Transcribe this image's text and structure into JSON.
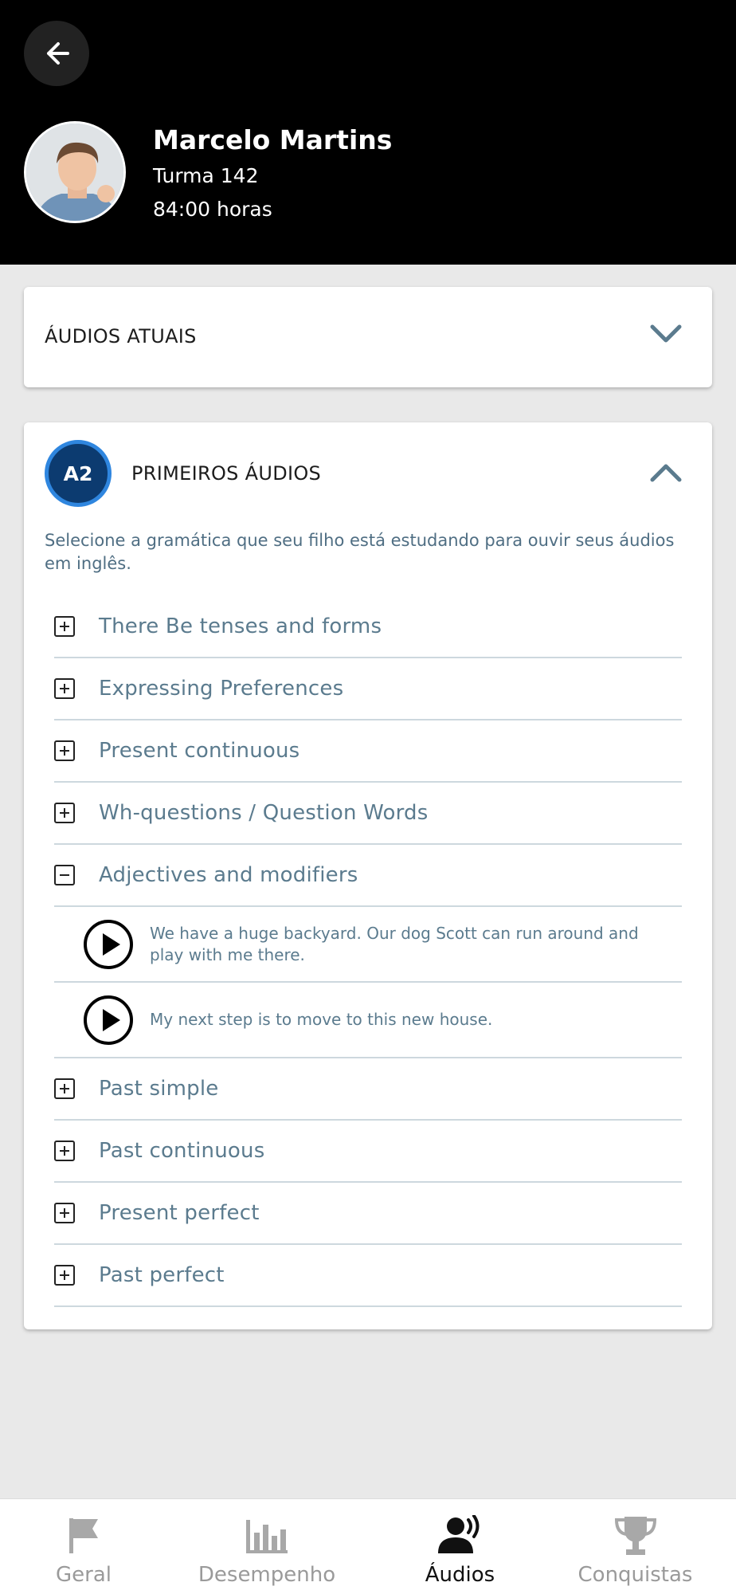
{
  "header": {
    "name": "Marcelo Martins",
    "class": "Turma 142",
    "hours": "84:00 horas"
  },
  "current_audios": {
    "title": "ÁUDIOS ATUAIS"
  },
  "first_audios": {
    "level": "A2",
    "title": "PRIMEIROS ÁUDIOS",
    "instructions": "Selecione a gramática que seu filho está estudando para ouvir seus áudios em inglês.",
    "topics": [
      {
        "label": "There Be tenses and forms"
      },
      {
        "label": "Expressing Preferences"
      },
      {
        "label": "Present continuous"
      },
      {
        "label": "Wh-questions / Question Words"
      },
      {
        "label": "Adjectives and modifiers"
      },
      {
        "label": "Past simple"
      },
      {
        "label": "Past continuous"
      },
      {
        "label": "Present perfect"
      },
      {
        "label": "Past perfect"
      }
    ],
    "expanded_audios": [
      {
        "text": "We have a huge backyard. Our dog Scott can run around and play with me there."
      },
      {
        "text": "My next step is to move to this new house."
      }
    ]
  },
  "nav": {
    "items": [
      {
        "label": "Geral",
        "icon": "flag-icon"
      },
      {
        "label": "Desempenho",
        "icon": "bar-chart-icon"
      },
      {
        "label": "Áudios",
        "icon": "speaking-person-icon"
      },
      {
        "label": "Conquistas",
        "icon": "trophy-icon"
      }
    ],
    "active": "Áudios"
  },
  "colors": {
    "header_bg": "#000000",
    "badge_bg": "#0c3b70",
    "badge_ring": "#2f86df",
    "text_muted": "#5b7b8e"
  }
}
